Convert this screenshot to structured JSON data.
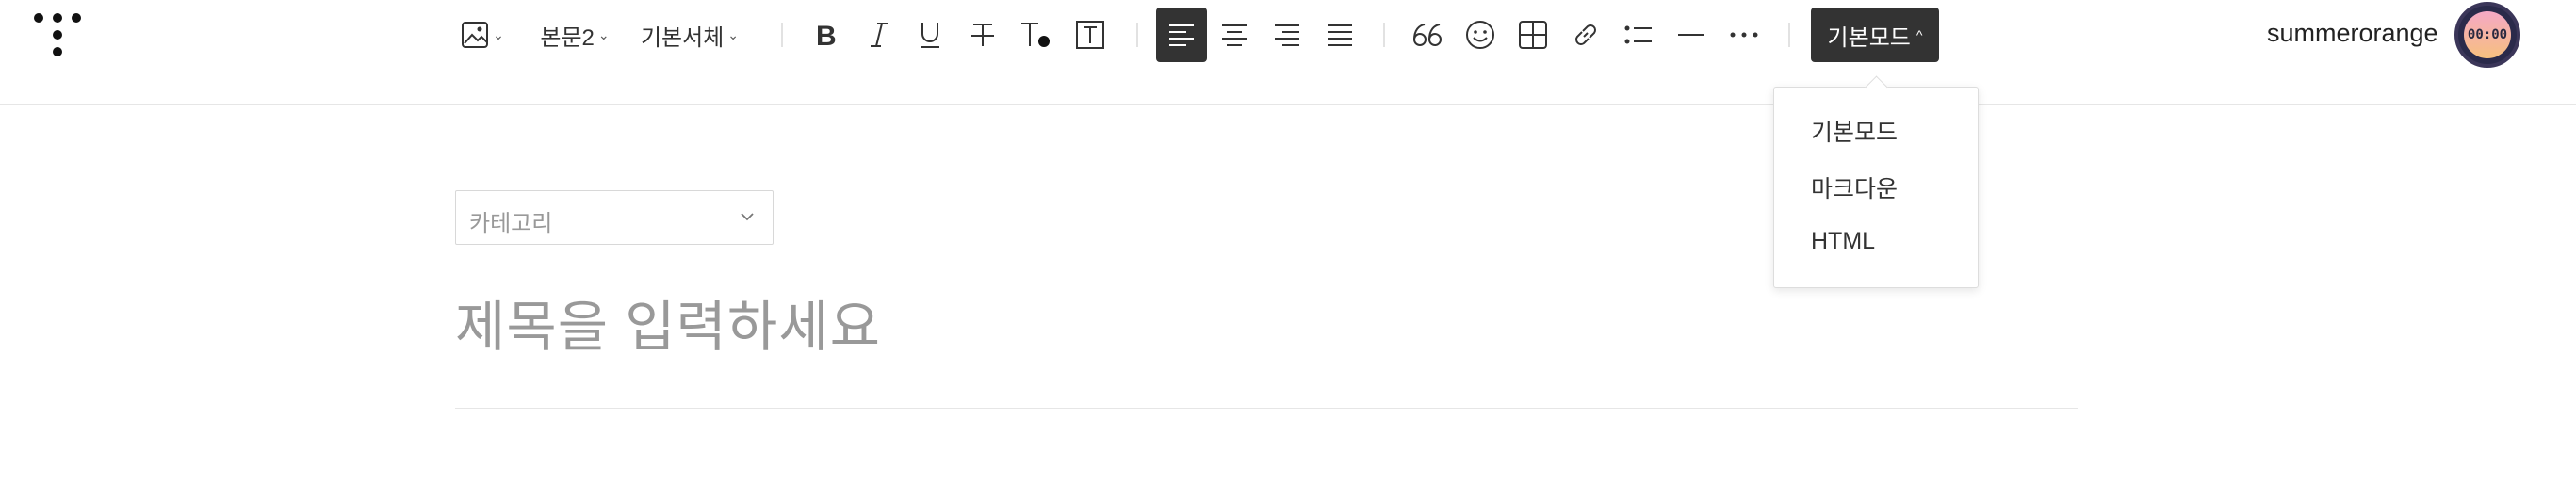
{
  "toolbar": {
    "text_style": "본문2",
    "font_family": "기본서체",
    "mode_button": "기본모드",
    "icons": {
      "image": "image-icon",
      "bold": "bold-icon",
      "italic": "italic-icon",
      "underline": "underline-icon",
      "strikethrough": "strikethrough-icon",
      "text_color": "text-color-icon",
      "text_background": "text-background-icon",
      "align_left": "align-left-icon",
      "align_center": "align-center-icon",
      "align_right": "align-right-icon",
      "align_justify": "align-justify-icon",
      "quote": "quote-icon",
      "emoticon": "emoticon-icon",
      "table": "table-icon",
      "link": "link-icon",
      "list": "list-icon",
      "divider": "divider-icon",
      "more": "more-icon"
    },
    "active_alignment": "left"
  },
  "user": {
    "name": "summerorange",
    "avatar_text": "00:00"
  },
  "mode_dropdown": {
    "items": [
      "기본모드",
      "마크다운",
      "HTML"
    ]
  },
  "editor": {
    "category_placeholder": "카테고리",
    "title_placeholder": "제목을 입력하세요"
  },
  "colors": {
    "active_background": "#333333",
    "placeholder": "#999999",
    "border": "#e6e6e6"
  }
}
